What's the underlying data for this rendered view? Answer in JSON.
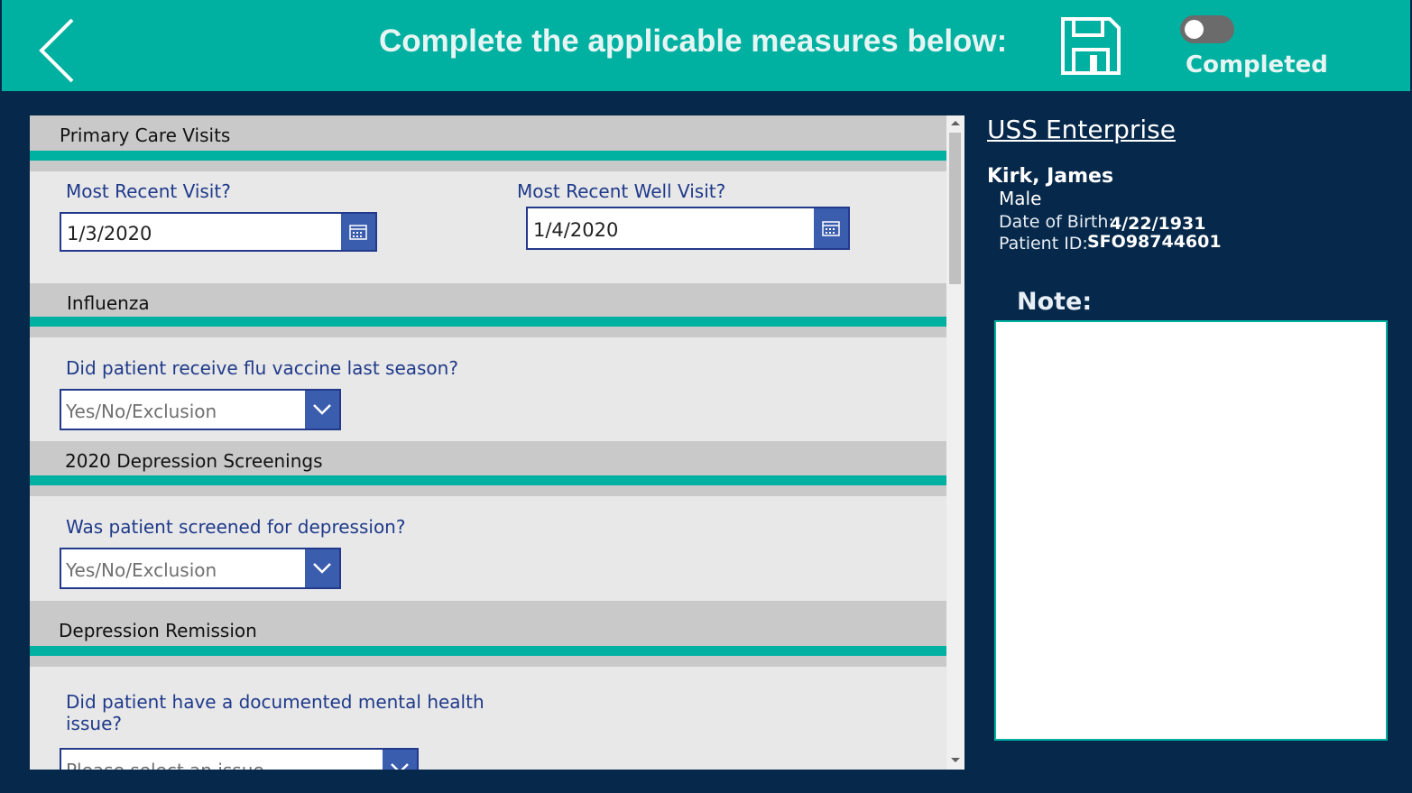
{
  "header": {
    "title": "Complete the applicable measures below:",
    "toggle_label": "Completed",
    "toggle_on": false,
    "accent_color": "#00b0a0"
  },
  "sections": {
    "primary_care": {
      "title": "Primary Care Visits",
      "recent_visit_label": "Most Recent Visit?",
      "recent_visit_value": "1/3/2020",
      "well_visit_label": "Most Recent Well Visit?",
      "well_visit_value": "1/4/2020"
    },
    "influenza": {
      "title": "Influenza",
      "question": "Did patient receive flu vaccine last season?",
      "placeholder": "Yes/No/Exclusion"
    },
    "depression_screening": {
      "title": "2020 Depression Screenings",
      "question": "Was patient screened for depression?",
      "placeholder": "Yes/No/Exclusion"
    },
    "depression_remission": {
      "title": "Depression Remission",
      "question_line1": "Did patient have a documented mental health",
      "question_line2": "issue?",
      "placeholder": "Please select an issue"
    }
  },
  "patient": {
    "organization": "USS Enterprise",
    "name": "Kirk, James",
    "sex": "Male",
    "dob_label": "Date of Birth:",
    "dob_value": "4/22/1931",
    "id_label": "Patient ID:",
    "id_value": "SFO98744601"
  },
  "note": {
    "label": "Note:",
    "value": ""
  },
  "icons": {
    "back": "chevron-left-icon",
    "save": "floppy-disk-icon",
    "calendar": "calendar-icon",
    "dropdown": "chevron-down-icon"
  }
}
